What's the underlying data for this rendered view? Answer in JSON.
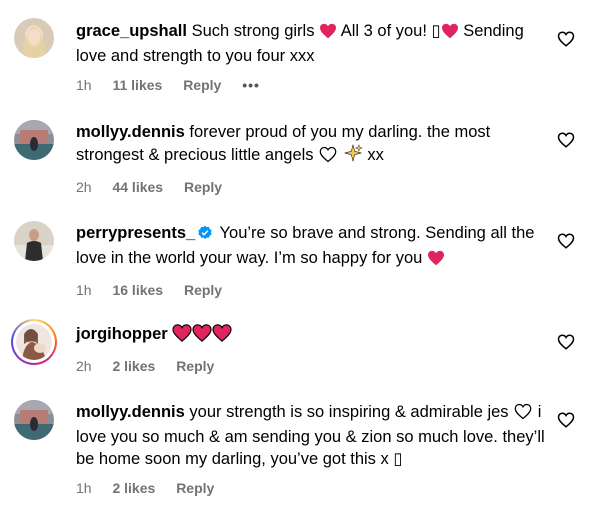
{
  "comments": [
    {
      "username": "grace_upshall",
      "text_parts": [
        "Such strong girls ",
        " All 3 of you! ▯",
        " Sending love and strength to you four xxx"
      ],
      "time": "1h",
      "likes": "11 likes",
      "reply": "Reply",
      "more": "•••"
    },
    {
      "username": "mollyy.dennis",
      "text_parts": [
        "forever proud of you my darling. the most strongest & precious little angels ",
        " xx"
      ],
      "time": "2h",
      "likes": "44 likes",
      "reply": "Reply"
    },
    {
      "username": "perrypresents_",
      "text_parts": [
        "You’re so brave and strong. Sending all the love in the world your way. I’m so happy for you "
      ],
      "time": "1h",
      "likes": "16 likes",
      "reply": "Reply"
    },
    {
      "username": "jorgihopper",
      "text_parts": [
        ""
      ],
      "time": "2h",
      "likes": "2 likes",
      "reply": "Reply"
    },
    {
      "username": "mollyy.dennis",
      "text_parts": [
        "your strength is so inspiring & admirable jes ",
        " i love you so much & am sending you & zion so much love. they’ll be home soon my darling, you’ve got this x ▯"
      ],
      "time": "1h",
      "likes": "2 likes",
      "reply": "Reply"
    }
  ],
  "colors": {
    "heart_red": "#e0245e",
    "meta_grey": "#737373",
    "verified_blue": "#0095f6"
  }
}
